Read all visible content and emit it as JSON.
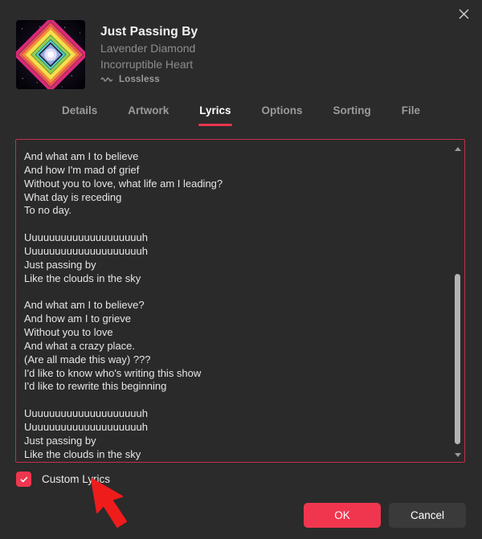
{
  "window": {
    "close_icon": "close-icon"
  },
  "track": {
    "title": "Just Passing By",
    "artist": "Lavender Diamond",
    "album": "Incorruptible Heart",
    "quality_label": "Lossless",
    "quality_icon": "lossless-waveform-icon",
    "artwork_alt": "album-artwork-diamond"
  },
  "tabs": [
    {
      "label": "Details",
      "active": false
    },
    {
      "label": "Artwork",
      "active": false
    },
    {
      "label": "Lyrics",
      "active": true
    },
    {
      "label": "Options",
      "active": false
    },
    {
      "label": "Sorting",
      "active": false
    },
    {
      "label": "File",
      "active": false
    }
  ],
  "lyrics": {
    "text": "And what am I to believe\nAnd how I'm mad of grief\nWithout you to love, what life am I leading?\nWhat day is receding\nTo no day.\n\nUuuuuuuuuuuuuuuuuuuuh\nUuuuuuuuuuuuuuuuuuuuh\nJust passing by\nLike the clouds in the sky\n\nAnd what am I to believe?\nAnd how am I to grieve\nWithout you to love\nAnd what a crazy place.\n(Are all made this way) ???\nI'd like to know who's writing this show\nI'd like to rewrite this beginning\n\nUuuuuuuuuuuuuuuuuuuuh\nUuuuuuuuuuuuuuuuuuuuh\nJust passing by\nLike the clouds in the sky",
    "scroll_up_icon": "scroll-up-arrow-icon",
    "scroll_down_icon": "scroll-down-arrow-icon"
  },
  "footer": {
    "custom_lyrics_label": "Custom Lyrics",
    "custom_lyrics_checked": true,
    "check_icon": "checkmark-icon",
    "ok_label": "OK",
    "cancel_label": "Cancel",
    "annotation_icon": "red-arrow-pointer"
  },
  "colors": {
    "accent_red": "#f0364f",
    "tab_underline": "#e8354f",
    "focus_border": "#c0304a",
    "background": "#2b2b2b",
    "field_background": "#2a2a2a",
    "cancel_button": "#3a3a3a",
    "muted_text": "#8d8d8d",
    "annotation_red": "#ef1c1c"
  }
}
